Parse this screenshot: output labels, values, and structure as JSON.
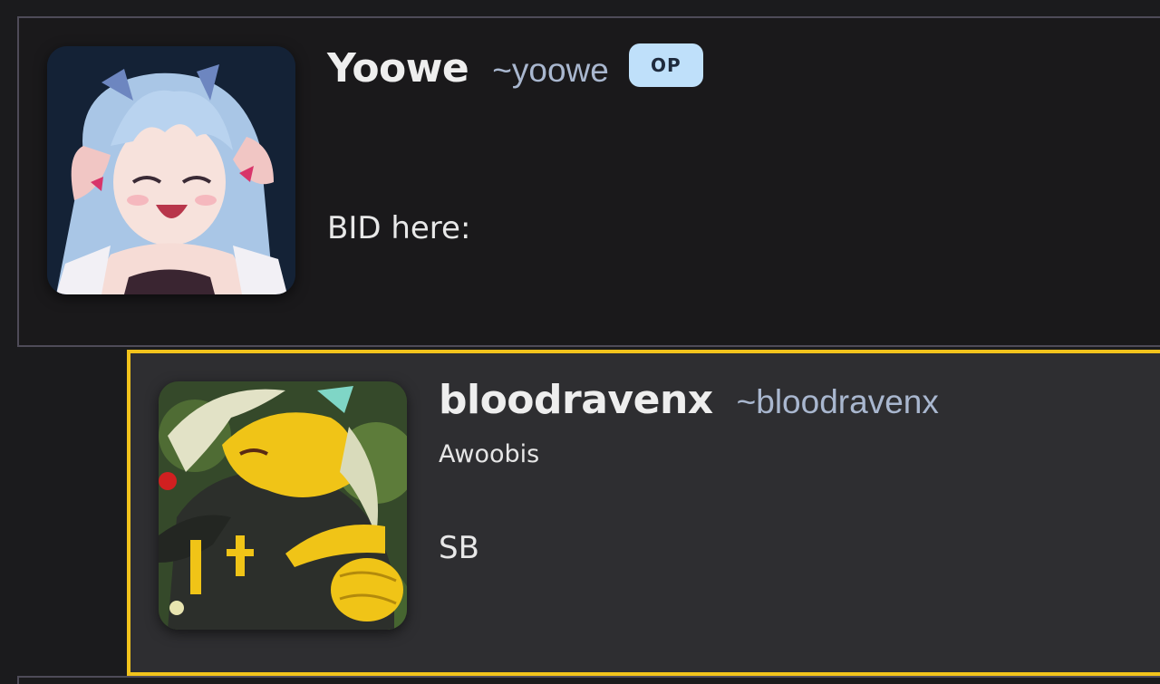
{
  "comments": [
    {
      "display_name": "Yoowe",
      "username": "~yoowe",
      "badge": "OP",
      "body": "BID here:",
      "avatar_icon": "anime-girl-avatar-icon"
    },
    {
      "display_name": "bloodravenx",
      "username": "~bloodravenx",
      "subtitle": "Awoobis",
      "body": "SB",
      "avatar_icon": "yellow-black-creature-avatar-icon"
    }
  ],
  "colors": {
    "page_bg": "#1b1b1d",
    "op_border": "#4e4b58",
    "reply_border": "#f2c31c",
    "reply_bg": "#2e2e31",
    "badge_bg": "#bfe0fa",
    "username": "#a9b7cf"
  }
}
